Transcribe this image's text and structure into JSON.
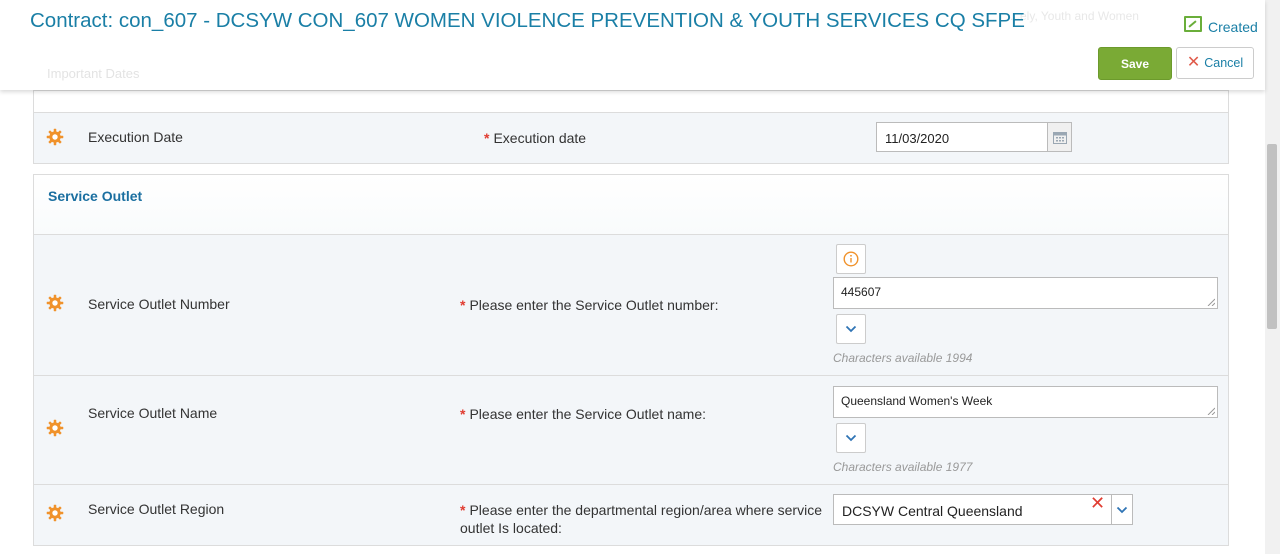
{
  "header": {
    "title": "Contract: con_607 - DCSYW CON_607 WOMEN VIOLENCE PREVENTION & YOUTH SERVICES CQ SFPE",
    "faded_subtitle": "...ely, Youth and Women",
    "faded_section": "Important Dates",
    "status_label": "Created",
    "save_label": "Save",
    "cancel_label": "Cancel"
  },
  "execution": {
    "label": "Execution Date",
    "question": "Execution date",
    "value": "11/03/2020"
  },
  "service_outlet": {
    "title": "Service Outlet",
    "number": {
      "label": "Service Outlet Number",
      "question": "Please enter the Service Outlet number:",
      "value": "445607",
      "chars": "Characters available 1994"
    },
    "name": {
      "label": "Service Outlet Name",
      "question": "Please enter the Service Outlet name:",
      "value": "Queensland Women's Week",
      "chars": "Characters available 1977"
    },
    "region": {
      "label": "Service Outlet Region",
      "question_line1": "Please enter the departmental region/area where service",
      "question_line2": "outlet Is located:",
      "value": "DCSYW Central Queensland"
    }
  },
  "colors": {
    "accent": "#1a7fa6",
    "save": "#7aaa35",
    "required": "#e03c31",
    "gear": "#f0922b"
  }
}
